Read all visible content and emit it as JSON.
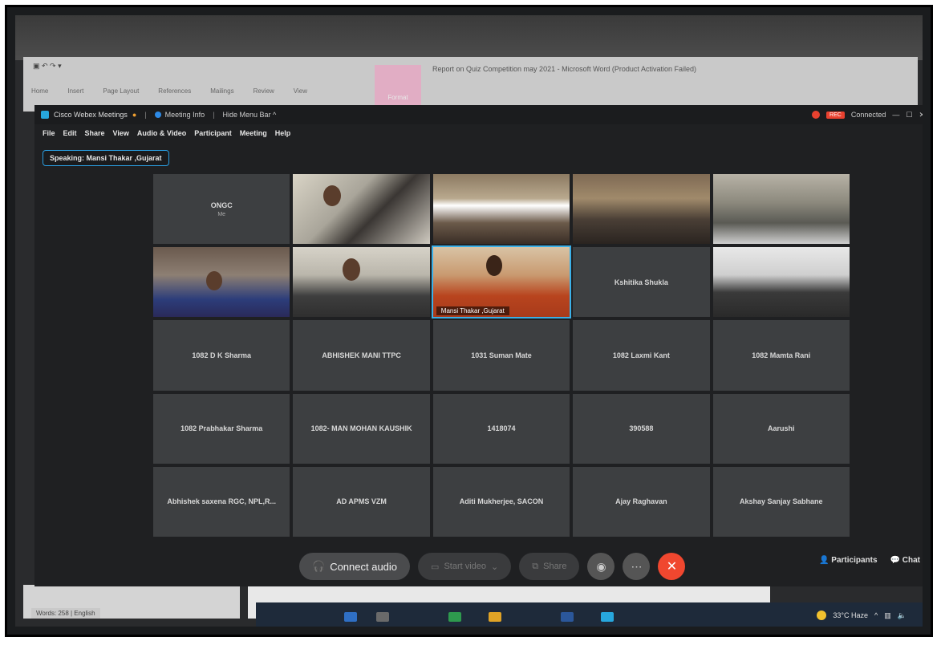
{
  "word": {
    "title": "Report on Quiz Competition may 2021 - Microsoft Word (Product Activation Failed)",
    "active_tab": "Format",
    "tabs": [
      "Home",
      "Insert",
      "Page Layout",
      "References",
      "Mailings",
      "Review",
      "View"
    ]
  },
  "webex": {
    "app_name": "Cisco Webex Meetings",
    "meeting_info": "Meeting Info",
    "hide_menu": "Hide Menu Bar ^",
    "connection": "Connected",
    "rec_badge": "REC",
    "menu": [
      "File",
      "Edit",
      "Share",
      "View",
      "Audio & Video",
      "Participant",
      "Meeting",
      "Help"
    ],
    "speaking": "Speaking: Mansi Thakar ,Gujarat",
    "tiles": [
      {
        "name": "ONGC",
        "sub": "Me"
      },
      {
        "name": ""
      },
      {
        "name": ""
      },
      {
        "name": ""
      },
      {
        "name": ""
      },
      {
        "name": ""
      },
      {
        "name": ""
      },
      {
        "name": "Mansi Thakar ,Gujarat"
      },
      {
        "name": "Kshitika Shukla"
      },
      {
        "name": ""
      },
      {
        "name": "1082 D K Sharma"
      },
      {
        "name": "ABHISHEK MANI TTPC"
      },
      {
        "name": "1031 Suman Mate"
      },
      {
        "name": "1082 Laxmi Kant"
      },
      {
        "name": "1082 Mamta Rani"
      },
      {
        "name": "1082 Prabhakar Sharma"
      },
      {
        "name": "1082- MAN MOHAN KAUSHIK"
      },
      {
        "name": "1418074"
      },
      {
        "name": "390588"
      },
      {
        "name": "Aarushi"
      },
      {
        "name": "Abhishek saxena RGC, NPL,R..."
      },
      {
        "name": "AD APMS VZM"
      },
      {
        "name": "Aditi Mukherjee, SACON"
      },
      {
        "name": "Ajay Raghavan"
      },
      {
        "name": "Akshay Sanjay Sabhane"
      }
    ],
    "controls": {
      "connect_audio": "Connect audio",
      "start_video": "Start video",
      "share": "Share",
      "participants": "Participants",
      "chat": "Chat"
    }
  },
  "taskbar": {
    "weather": "33°C Haze",
    "status_left": "Words: 258 | English"
  }
}
